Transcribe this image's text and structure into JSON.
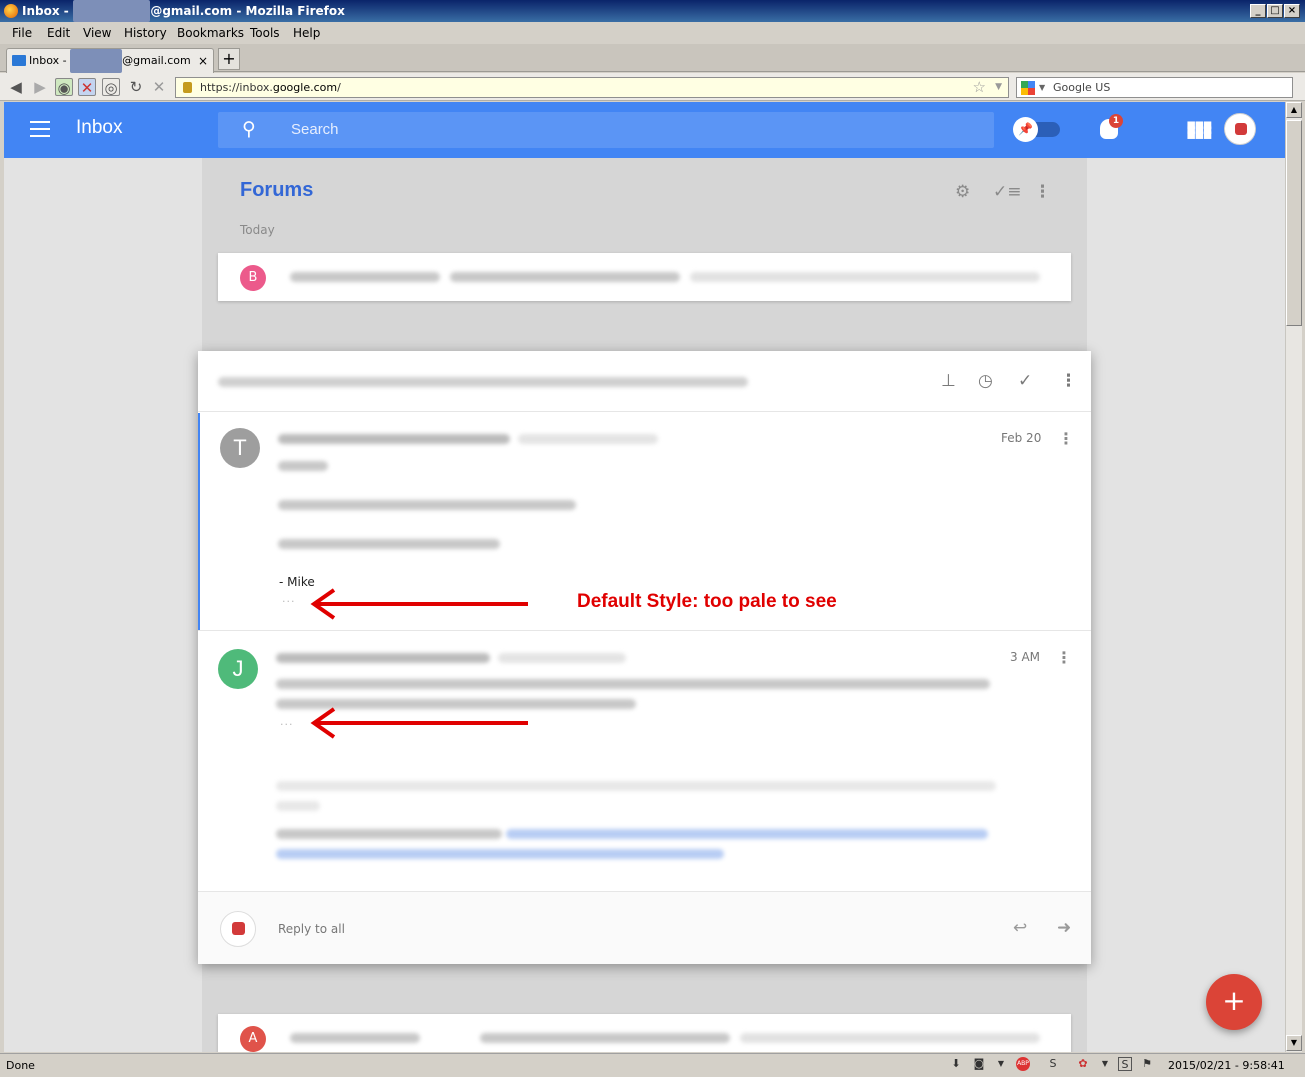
{
  "window": {
    "title_prefix": "Inbox - ",
    "title_suffix": "@gmail.com - Mozilla Firefox",
    "controls": [
      "_",
      "□",
      "×"
    ]
  },
  "menu": [
    "File",
    "Edit",
    "View",
    "History",
    "Bookmarks",
    "Tools",
    "Help"
  ],
  "tab": {
    "label_prefix": "Inbox - ",
    "label_suffix": "@gmail.com",
    "close": "×",
    "new_tab": "+"
  },
  "nav": {
    "url_prefix": "https://inbox.",
    "url_host": "google.com",
    "url_suffix": "/",
    "search_engine": "Google US"
  },
  "app": {
    "brand": "Inbox",
    "search_placeholder": "Search",
    "notification_count": "1"
  },
  "bundle": {
    "title": "Forums",
    "section": "Today",
    "top_item_avatar": "B",
    "bottom_item_avatar": "A"
  },
  "thread": {
    "messages": [
      {
        "avatar": "T",
        "date": "Feb 20",
        "signature": "- Mike",
        "ellipsis": "···"
      },
      {
        "avatar": "J",
        "date": "3 AM",
        "ellipsis": "···"
      }
    ],
    "reply_label": "Reply to all"
  },
  "annotation": {
    "text": "Default Style: too pale to see"
  },
  "statusbar": {
    "status": "Done",
    "clock": "2015/02/21 - 9:58:41"
  },
  "colors": {
    "brand_blue": "#4285f4",
    "annotation_red": "#e00000",
    "fab_red": "#db4437",
    "avatar_T": "#9e9e9e",
    "avatar_J": "#4fba7a",
    "avatar_B": "#ec5a8b",
    "avatar_A": "#e0534a"
  }
}
